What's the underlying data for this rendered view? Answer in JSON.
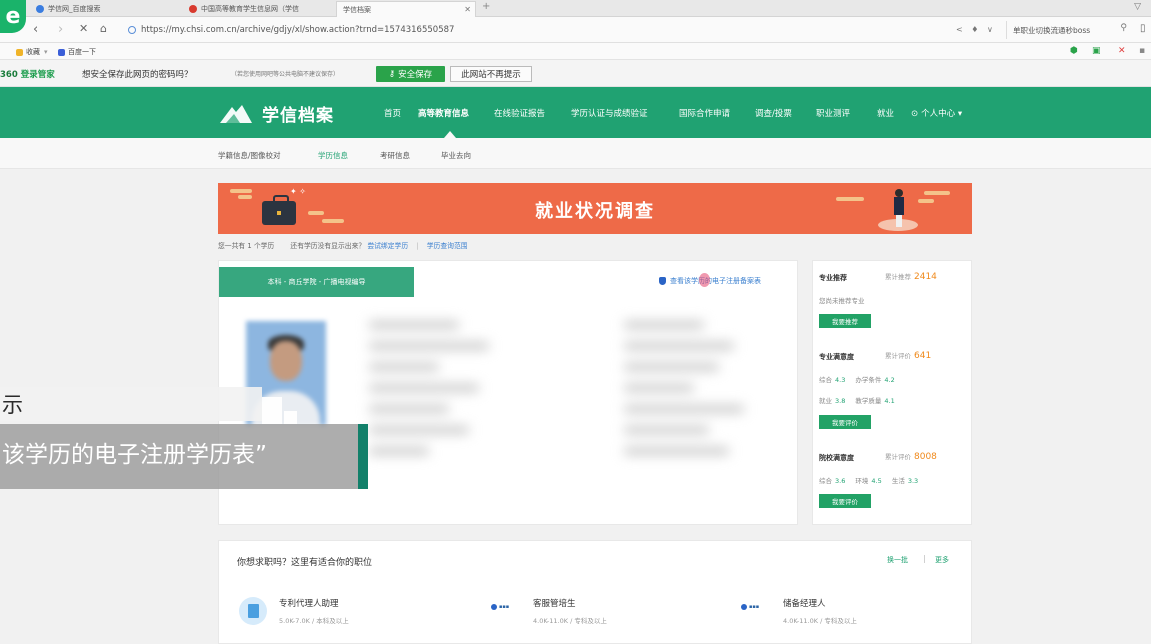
{
  "browser": {
    "tabs": [
      {
        "title": "学信网_百度搜索",
        "favicon_color": "#3b7de0"
      },
      {
        "title": "中国高等教育学生信息网（学信",
        "favicon_color": "#d83a2e"
      },
      {
        "title": "学信档案",
        "favicon_color": "#cccccc"
      }
    ],
    "new_tab": "+",
    "url": "https://my.chsi.com.cn/archive/gdjy/xl/show.action?trnd=1574316550587",
    "search_text": "单职业切换流通秒boss",
    "bookmarks": [
      "收藏",
      "百度一下"
    ],
    "savebar": {
      "logo_num": "360",
      "logo_text": "登录管家",
      "question": "想安全保存此网页的密码吗？",
      "note": "（若您使用网吧等公共电脑不建议保存）",
      "save_button": "安全保存",
      "never_button": "此网站不再提示"
    }
  },
  "site": {
    "logo_text": "学信档案",
    "nav": [
      {
        "label": "首页",
        "active": false
      },
      {
        "label": "高等教育信息",
        "active": true
      },
      {
        "label": "在线验证报告",
        "active": false
      },
      {
        "label": "学历认证与成绩验证",
        "active": false
      },
      {
        "label": "国际合作申请",
        "active": false
      },
      {
        "label": "调查/投票",
        "active": false
      },
      {
        "label": "职业测评",
        "active": false
      },
      {
        "label": "就业",
        "active": false
      },
      {
        "label": "个人中心 ▾",
        "active": false
      }
    ],
    "subnav": [
      {
        "label": "学籍信息/图像校对",
        "active": false
      },
      {
        "label": "学历信息",
        "active": true
      },
      {
        "label": "考研信息",
        "active": false
      },
      {
        "label": "毕业去向",
        "active": false
      }
    ]
  },
  "banner": {
    "title": "就业状况调查"
  },
  "info_line": {
    "count_text": "您一共有 1 个学历",
    "missing_text": "还有学历没有显示出来？",
    "link1": "尝试绑定学历",
    "link2": "学历查询范围"
  },
  "degree_card": {
    "tab": "本科 - 商丘学院 - 广播电视编导",
    "reg_link": "查看该学历的电子注册备案表"
  },
  "side_panel": {
    "major_rec": {
      "title": "专业推荐",
      "count_label": "累计推荐",
      "count": "2414",
      "desc": "您尚未推荐专业",
      "button": "我要推荐"
    },
    "major_sat": {
      "title": "专业满意度",
      "count_label": "累计评价",
      "count": "641",
      "rows": [
        [
          {
            "k": "综合",
            "v": "4.3"
          },
          {
            "k": "办学条件",
            "v": "4.2"
          }
        ],
        [
          {
            "k": "就业",
            "v": "3.8"
          },
          {
            "k": "教学质量",
            "v": "4.1"
          }
        ]
      ],
      "button": "我要评价"
    },
    "school_sat": {
      "title": "院校满意度",
      "count_label": "累计评价",
      "count": "8008",
      "rows": [
        [
          {
            "k": "综合",
            "v": "3.6"
          },
          {
            "k": "环境",
            "v": "4.5"
          },
          {
            "k": "生活",
            "v": "3.3"
          }
        ]
      ],
      "button": "我要评价"
    }
  },
  "jobs": {
    "title": "你想求职吗？这里有适合你的职位",
    "refresh": "换一批",
    "more": "更多",
    "items": [
      {
        "name": "专利代理人助理",
        "salary": "5.0K-7.0K",
        "edu": "本科及以上"
      },
      {
        "name": "客服管培生",
        "salary": "4.0K-11.0K",
        "edu": "专科及以上"
      },
      {
        "name": "储备经理人",
        "salary": "4.0K-11.0K",
        "edu": "专科及以上"
      }
    ]
  },
  "subtitles": {
    "line1": "示",
    "line2": "该学历的电子注册学历表”"
  }
}
